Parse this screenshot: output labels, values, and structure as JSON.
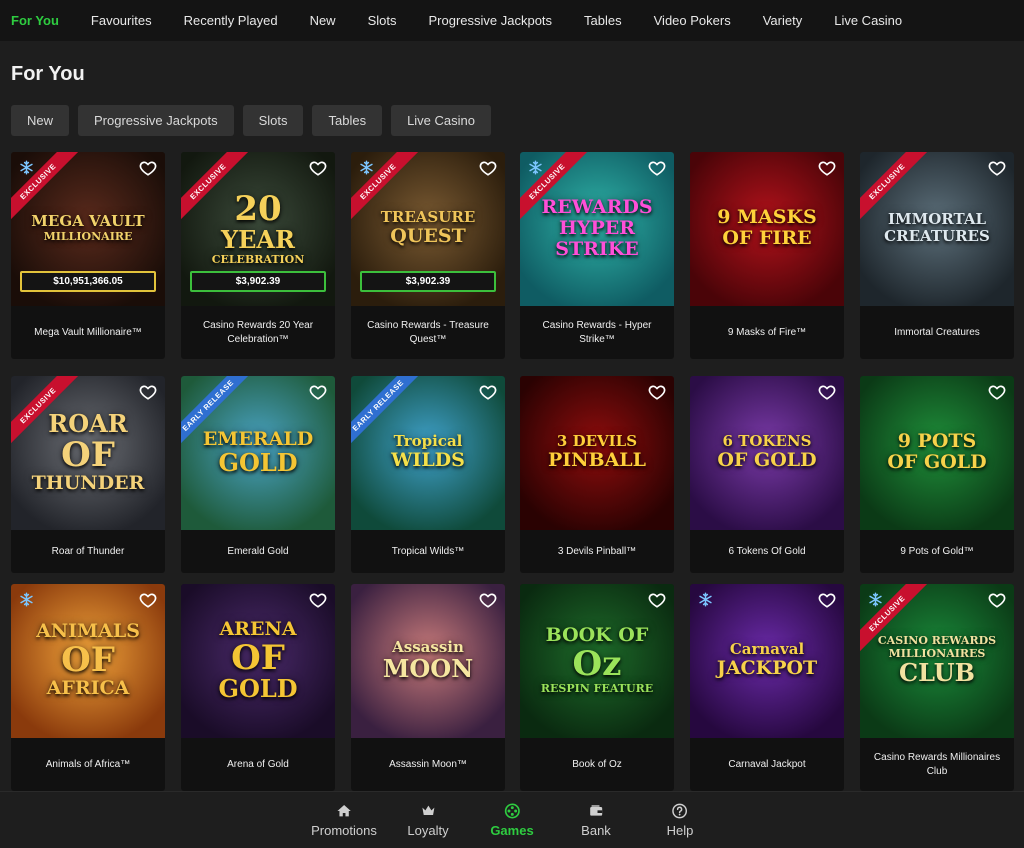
{
  "top_tabs": [
    {
      "label": "For You",
      "active": true
    },
    {
      "label": "Favourites"
    },
    {
      "label": "Recently Played"
    },
    {
      "label": "New"
    },
    {
      "label": "Slots"
    },
    {
      "label": "Progressive Jackpots"
    },
    {
      "label": "Tables"
    },
    {
      "label": "Video Pokers"
    },
    {
      "label": "Variety"
    },
    {
      "label": "Live Casino"
    }
  ],
  "page_title": "For You",
  "filters": [
    "New",
    "Progressive Jackpots",
    "Slots",
    "Tables",
    "Live Casino"
  ],
  "games": [
    {
      "name": "Mega Vault Millionaire™",
      "ribbon": "EXCLUSIVE",
      "snowflake": true,
      "jackpot": "$10,951,366.05",
      "jackpot_color": "#e2c33b",
      "art_lines": [
        "MEGA VAULT",
        "MILLIONAIRE"
      ],
      "colors": [
        "#5a2a1c",
        "#1a0d08"
      ],
      "art_color": "#f2d36b"
    },
    {
      "name": "Casino Rewards 20 Year Celebration™",
      "ribbon": "EXCLUSIVE",
      "jackpot": "$3,902.39",
      "jackpot_color": "#3cbf3c",
      "art_lines": [
        "20",
        "YEAR",
        "CELEBRATION"
      ],
      "colors": [
        "#3b4a3a",
        "#12180f"
      ],
      "art_color": "#f5d15a"
    },
    {
      "name": "Casino Rewards - Treasure Quest™",
      "ribbon": "EXCLUSIVE",
      "snowflake": true,
      "jackpot": "$3,902.39",
      "jackpot_color": "#3cbf3c",
      "art_lines": [
        "TREASURE",
        "QUEST"
      ],
      "colors": [
        "#7a5a32",
        "#2b1d0c"
      ],
      "art_color": "#f0c55a"
    },
    {
      "name": "Casino Rewards - Hyper Strike™",
      "ribbon": "EXCLUSIVE",
      "snowflake": true,
      "art_lines": [
        "REWARDS",
        "HYPER",
        "STRIKE"
      ],
      "colors": [
        "#2fb3a8",
        "#0f5c63"
      ],
      "art_color": "#ff4fd8"
    },
    {
      "name": "9 Masks of Fire™",
      "art_lines": [
        "9 MASKS",
        "OF FIRE"
      ],
      "colors": [
        "#b3121b",
        "#4a0408"
      ],
      "art_color": "#ffd23a"
    },
    {
      "name": "Immortal Creatures",
      "ribbon": "EXCLUSIVE",
      "art_lines": [
        "IMMORTAL",
        "CREATURES"
      ],
      "colors": [
        "#5c6f7a",
        "#1e262c"
      ],
      "art_color": "#dfe9ef"
    },
    {
      "name": "Roar of Thunder",
      "ribbon": "EXCLUSIVE",
      "art_lines": [
        "ROAR",
        "OF",
        "THUNDER"
      ],
      "colors": [
        "#6b6e74",
        "#22242a"
      ],
      "art_color": "#f4d27a"
    },
    {
      "name": "Emerald Gold",
      "ribbon": "EARLY RELEASE",
      "ribbon_blue": true,
      "art_lines": [
        "EMERALD",
        "GOLD"
      ],
      "colors": [
        "#4aa3c4",
        "#1e5a3a"
      ],
      "art_color": "#f4c534"
    },
    {
      "name": "Tropical Wilds™",
      "ribbon": "EARLY RELEASE",
      "ribbon_blue": true,
      "art_lines": [
        "Tropical",
        "WILDS"
      ],
      "colors": [
        "#3fa0c9",
        "#0f4a3a"
      ],
      "art_color": "#f5e04a"
    },
    {
      "name": "3 Devils Pinball™",
      "art_lines": [
        "3 DEVILS",
        "PINBALL"
      ],
      "colors": [
        "#8f0d0d",
        "#2a0202"
      ],
      "art_color": "#ffcf3a"
    },
    {
      "name": "6 Tokens Of Gold",
      "art_lines": [
        "6 TOKENS",
        "OF GOLD"
      ],
      "colors": [
        "#7a3aa8",
        "#2b0d46"
      ],
      "art_color": "#f7d24a"
    },
    {
      "name": "9 Pots of Gold™",
      "art_lines": [
        "9 POTS",
        "OF GOLD"
      ],
      "colors": [
        "#1f8f3a",
        "#0b3a16"
      ],
      "art_color": "#f7d24a"
    },
    {
      "name": "Animals of Africa™",
      "snowflake": true,
      "art_lines": [
        "ANIMALS",
        "OF",
        "AFRICA"
      ],
      "colors": [
        "#f0a23a",
        "#8a3a0c"
      ],
      "art_color": "#f7c04a"
    },
    {
      "name": "Arena of Gold",
      "art_lines": [
        "ARENA",
        "OF",
        "GOLD"
      ],
      "colors": [
        "#4a2a6a",
        "#1a0c28"
      ],
      "art_color": "#f4c534"
    },
    {
      "name": "Assassin Moon™",
      "art_lines": [
        "Assassin",
        "MOON"
      ],
      "colors": [
        "#c77a7a",
        "#3a2040"
      ],
      "art_color": "#f5e6a0"
    },
    {
      "name": "Book of Oz",
      "art_lines": [
        "BOOK OF",
        "Oz",
        "RESPIN FEATURE"
      ],
      "colors": [
        "#1e6b2a",
        "#0a2a10"
      ],
      "art_color": "#9be35a"
    },
    {
      "name": "Carnaval Jackpot",
      "snowflake": true,
      "art_lines": [
        "Carnaval",
        "JACKPOT"
      ],
      "colors": [
        "#6a2aa8",
        "#26083f"
      ],
      "art_color": "#f7d24a"
    },
    {
      "name": "Casino Rewards Millionaires Club",
      "ribbon": "EXCLUSIVE",
      "snowflake": true,
      "art_lines": [
        "CASINO REWARDS",
        "MILLIONAIRES",
        "CLUB"
      ],
      "colors": [
        "#1a8a3a",
        "#0b3a16"
      ],
      "art_color": "#f2e2a0"
    }
  ],
  "bottom_nav": [
    {
      "label": "Promotions",
      "icon": "home-icon"
    },
    {
      "label": "Loyalty",
      "icon": "crown-icon"
    },
    {
      "label": "Games",
      "icon": "games-icon",
      "active": true
    },
    {
      "label": "Bank",
      "icon": "wallet-icon"
    },
    {
      "label": "Help",
      "icon": "help-icon"
    }
  ]
}
